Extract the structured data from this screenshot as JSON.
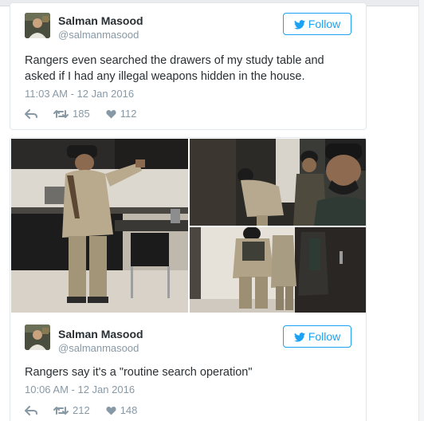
{
  "tweets": [
    {
      "author": {
        "name": "Salman Masood",
        "handle": "@salmanmasood"
      },
      "follow_label": "Follow",
      "text": "Rangers even searched the drawers of my study table and asked if I had any illegal weapons hidden in the house.",
      "time": "11:03 AM - 12 Jan 2016",
      "retweets": "185",
      "likes": "112"
    },
    {
      "author": {
        "name": "Salman Masood",
        "handle": "@salmanmasood"
      },
      "follow_label": "Follow",
      "text": "Rangers say it's a \"routine search operation\"",
      "time": "10:06 AM - 12 Jan 2016",
      "retweets": "212",
      "likes": "148"
    }
  ],
  "icons": {
    "follow": "twitter-bird-icon",
    "reply": "reply-arrow-icon",
    "retweet": "retweet-icon",
    "like": "heart-icon"
  },
  "colors": {
    "accent": "#1da1f2",
    "muted": "#8899a6",
    "text": "#292f33",
    "border": "#e1e8ed"
  }
}
